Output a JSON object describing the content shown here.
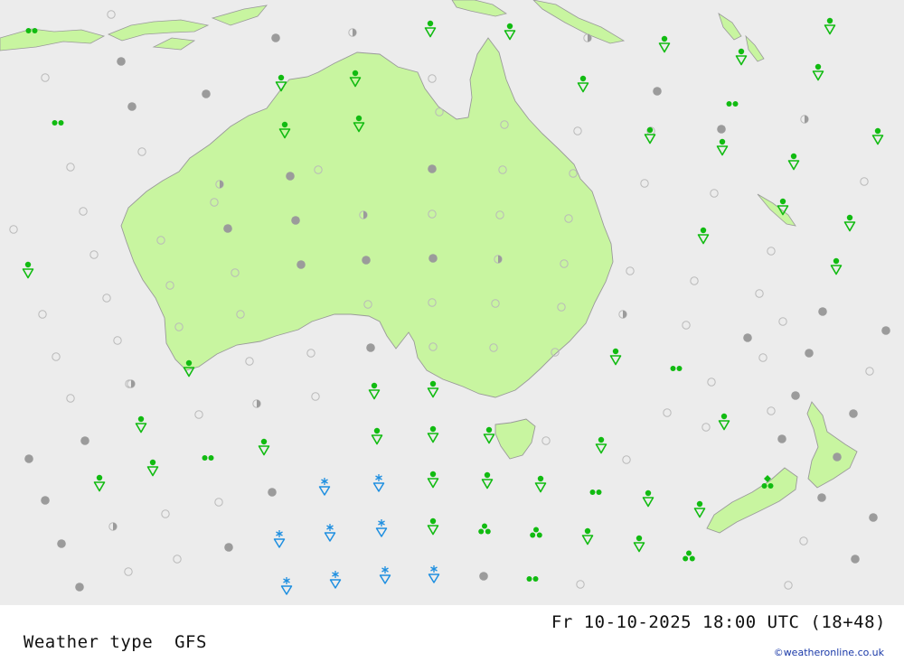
{
  "footer": {
    "product": "Weather type",
    "model": "GFS",
    "datetime": "Fr 10-10-2025 18:00 UTC (18+48)",
    "credit": "©weatheronline.co.uk"
  },
  "colors": {
    "sea": "#ececec",
    "land": "#c8f5a0",
    "coast": "#9a9a9a",
    "rain_green": "#11bb11",
    "snow_blue": "#1e8fe0",
    "overcast_grey": "#9b9b9b",
    "clear_outline": "#b9b9b9"
  },
  "symbol_legend": {
    "clear": "open-circle",
    "partly": "half-circle",
    "overcast": "grey-disc",
    "rain_shower": "green-shower-triangle",
    "rain": "green-double-dot",
    "heavy_rain": "green-triple-dot",
    "snow_shower": "blue-snow-triangle",
    "thunder": "green-diamond"
  }
}
